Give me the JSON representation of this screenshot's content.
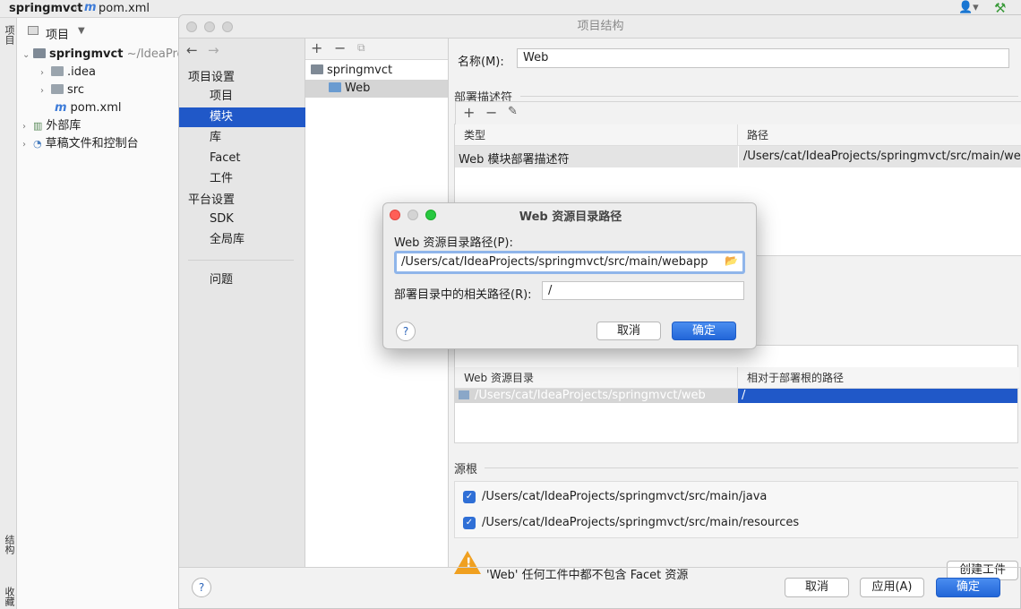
{
  "ide": {
    "project_name": "springmvct",
    "breadcrumb_file": "pom.xml",
    "project_toolbar_label": "项目",
    "tool_tab_project": "项目",
    "tool_tab_structure": "结构",
    "tool_tab_favorites": "收藏夹",
    "tree": {
      "root_name": "springmvct",
      "root_path": "~/IdeaPro",
      "items": [
        {
          "label": ".idea"
        },
        {
          "label": "src"
        },
        {
          "label": "pom.xml"
        },
        {
          "label": "外部库"
        },
        {
          "label": "草稿文件和控制台"
        }
      ]
    }
  },
  "dialog": {
    "title": "项目结构",
    "nav": {
      "project_settings_header": "项目设置",
      "items_project": [
        "项目",
        "模块",
        "库",
        "Facet",
        "工件"
      ],
      "platform_settings_header": "平台设置",
      "items_platform": [
        "SDK",
        "全局库"
      ],
      "problems": "问题"
    },
    "modules": {
      "root": "springmvct",
      "child": "Web"
    },
    "name_label": "名称(M):",
    "name_value": "Web",
    "deploy_descriptors_title": "部署描述符",
    "deploy_table": {
      "col_type": "类型",
      "col_path": "路径",
      "row_type": "Web 模块部署描述符",
      "row_path": "/Users/cat/IdeaProjects/springmvct/src/main/webapp"
    },
    "web_resource_table": {
      "col_dir": "Web 资源目录",
      "col_rel": "相对于部署根的路径",
      "row_dir": "/Users/cat/IdeaProjects/springmvct/web",
      "row_rel": "/"
    },
    "source_roots_title": "源根",
    "source_roots": [
      "/Users/cat/IdeaProjects/springmvct/src/main/java",
      "/Users/cat/IdeaProjects/springmvct/src/main/resources"
    ],
    "warning_text": "'Web' 任何工件中都不包含 Facet 资源",
    "create_artifact": "创建工件",
    "cancel": "取消",
    "apply": "应用(A)",
    "ok": "确定",
    "help": "?"
  },
  "modal": {
    "title": "Web 资源目录路径",
    "path_label": "Web 资源目录路径(P):",
    "path_value": "/Users/cat/IdeaProjects/springmvct/src/main/webapp",
    "rel_label": "部署目录中的相关路径(R):",
    "rel_value": "/",
    "cancel": "取消",
    "ok": "确定",
    "help": "?"
  },
  "colors": {
    "selection": "#2058c8",
    "primary_button": "#2a6ee0",
    "close_light": "#ff5f57",
    "minimize_light": "#febc2e",
    "zoom_light": "#28c840",
    "warning": "#f0a020"
  }
}
